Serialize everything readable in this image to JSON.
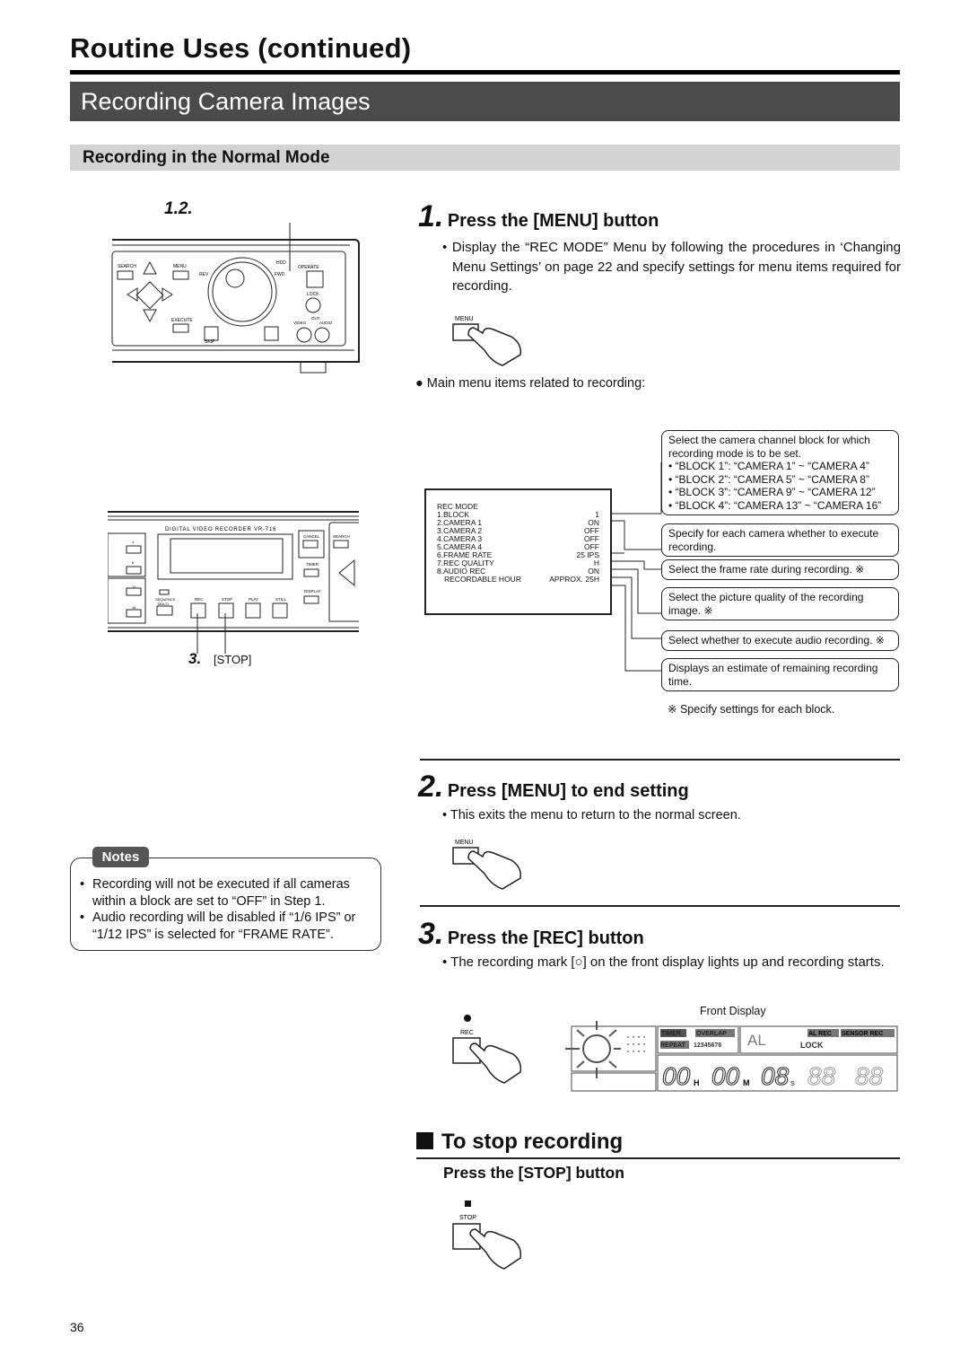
{
  "header": {
    "title": "Routine Uses (continued)",
    "section": "Recording Camera Images",
    "subsection": "Recording in the Normal Mode"
  },
  "device_top": {
    "callout": "1.2.",
    "labels": {
      "search": "SEARCH",
      "menu": "MENU",
      "execute": "EXECUTE",
      "rev": "REV",
      "fwd": "FWD",
      "hdd": "HDD",
      "operate": "OPERATE",
      "lock": "LOCK",
      "out": "OUT",
      "video": "VIDEO",
      "audio": "AUDIO",
      "skip": "SKIP"
    }
  },
  "device_bottom": {
    "model": "DIGITAL VIDEO RECORDER VR-716",
    "labels": {
      "cancel": "CANCEL",
      "search": "SEARCH",
      "timer": "TIMER",
      "display": "DISPLAY",
      "sequence": "SEQUENCE",
      "multi": "MULTI",
      "rec": "REC",
      "stop": "STOP",
      "play": "PLAY",
      "still": "STILL",
      "ch4": "4",
      "ch8": "8",
      "ch12": "12",
      "ch16": "16"
    },
    "callout_num": "3.",
    "callout_label": "[STOP]"
  },
  "step1": {
    "num": "1.",
    "heading": "Press the [MENU] button",
    "text": "Display the “REC MODE” Menu by following the procedures in ‘Changing Menu Settings’ on page 22 and specify settings for menu items required for recording.",
    "button_label": "MENU",
    "menu_note": "Main menu items related to recording:"
  },
  "menu": {
    "title": "REC MODE",
    "rows": [
      {
        "label": "1.BLOCK",
        "value": "1"
      },
      {
        "label": "2.CAMERA 1",
        "value": "ON"
      },
      {
        "label": "3.CAMERA 2",
        "value": "OFF"
      },
      {
        "label": "4.CAMERA 3",
        "value": "OFF"
      },
      {
        "label": "5.CAMERA 4",
        "value": "OFF"
      },
      {
        "label": "6.FRAME RATE",
        "value": "25 IPS"
      },
      {
        "label": "7.REC QUALITY",
        "value": "H"
      },
      {
        "label": "8.AUDIO REC",
        "value": "ON"
      },
      {
        "label": "RECORDABLE HOUR",
        "value": "APPROX. 25H"
      }
    ]
  },
  "callouts": {
    "block": {
      "text": "Select the camera channel block for which recording mode is to be set.",
      "items": [
        "• “BLOCK 1”: “CAMERA 1” ~ “CAMERA 4”",
        "• “BLOCK 2”: “CAMERA 5” ~ “CAMERA 8”",
        "• “BLOCK 3”: “CAMERA 9” ~ “CAMERA 12”",
        "• “BLOCK 4”: “CAMERA 13” ~ “CAMERA 16”"
      ]
    },
    "camera": "Specify for each camera whether to execute recording.",
    "frame_rate": "Select the frame rate during recording. ※",
    "quality": "Select the picture quality of the recording image. ※",
    "audio": "Select whether to execute audio recording. ※",
    "hours": "Displays an estimate of remaining recording time.",
    "footnote": "※ Specify settings for each block."
  },
  "step2": {
    "num": "2.",
    "heading": "Press [MENU] to end setting",
    "text": "This exits the menu to return to the normal screen.",
    "button_label": "MENU"
  },
  "notes": {
    "label": "Notes",
    "items": [
      "Recording will not be executed if all cameras within a block are set to “OFF” in Step 1.",
      "Audio recording will be disabled if “1/6 IPS” or “1/12 IPS” is selected for “FRAME RATE”."
    ]
  },
  "step3": {
    "num": "3.",
    "heading": "Press the [REC] button",
    "text": "The recording mark [○] on the front display lights up and recording starts.",
    "button_label": "REC",
    "display_label": "Front Display"
  },
  "front_display": {
    "timer": "TIMER",
    "overlap": "OVERLAP",
    "repeat": "REPEAT",
    "channels": "12345678",
    "al": "AL",
    "al_rec": "AL REC",
    "sensor_rec": "SENSOR REC",
    "lock": "LOCK",
    "time": "00H:00M:08S",
    "h": "H",
    "m": "M",
    "s": "S",
    "hh": "00",
    "mm": "00",
    "ss": "08"
  },
  "stop": {
    "heading": "To stop recording",
    "subheading": "Press the [STOP] button",
    "button_label": "STOP"
  },
  "footer": {
    "page": "36"
  }
}
